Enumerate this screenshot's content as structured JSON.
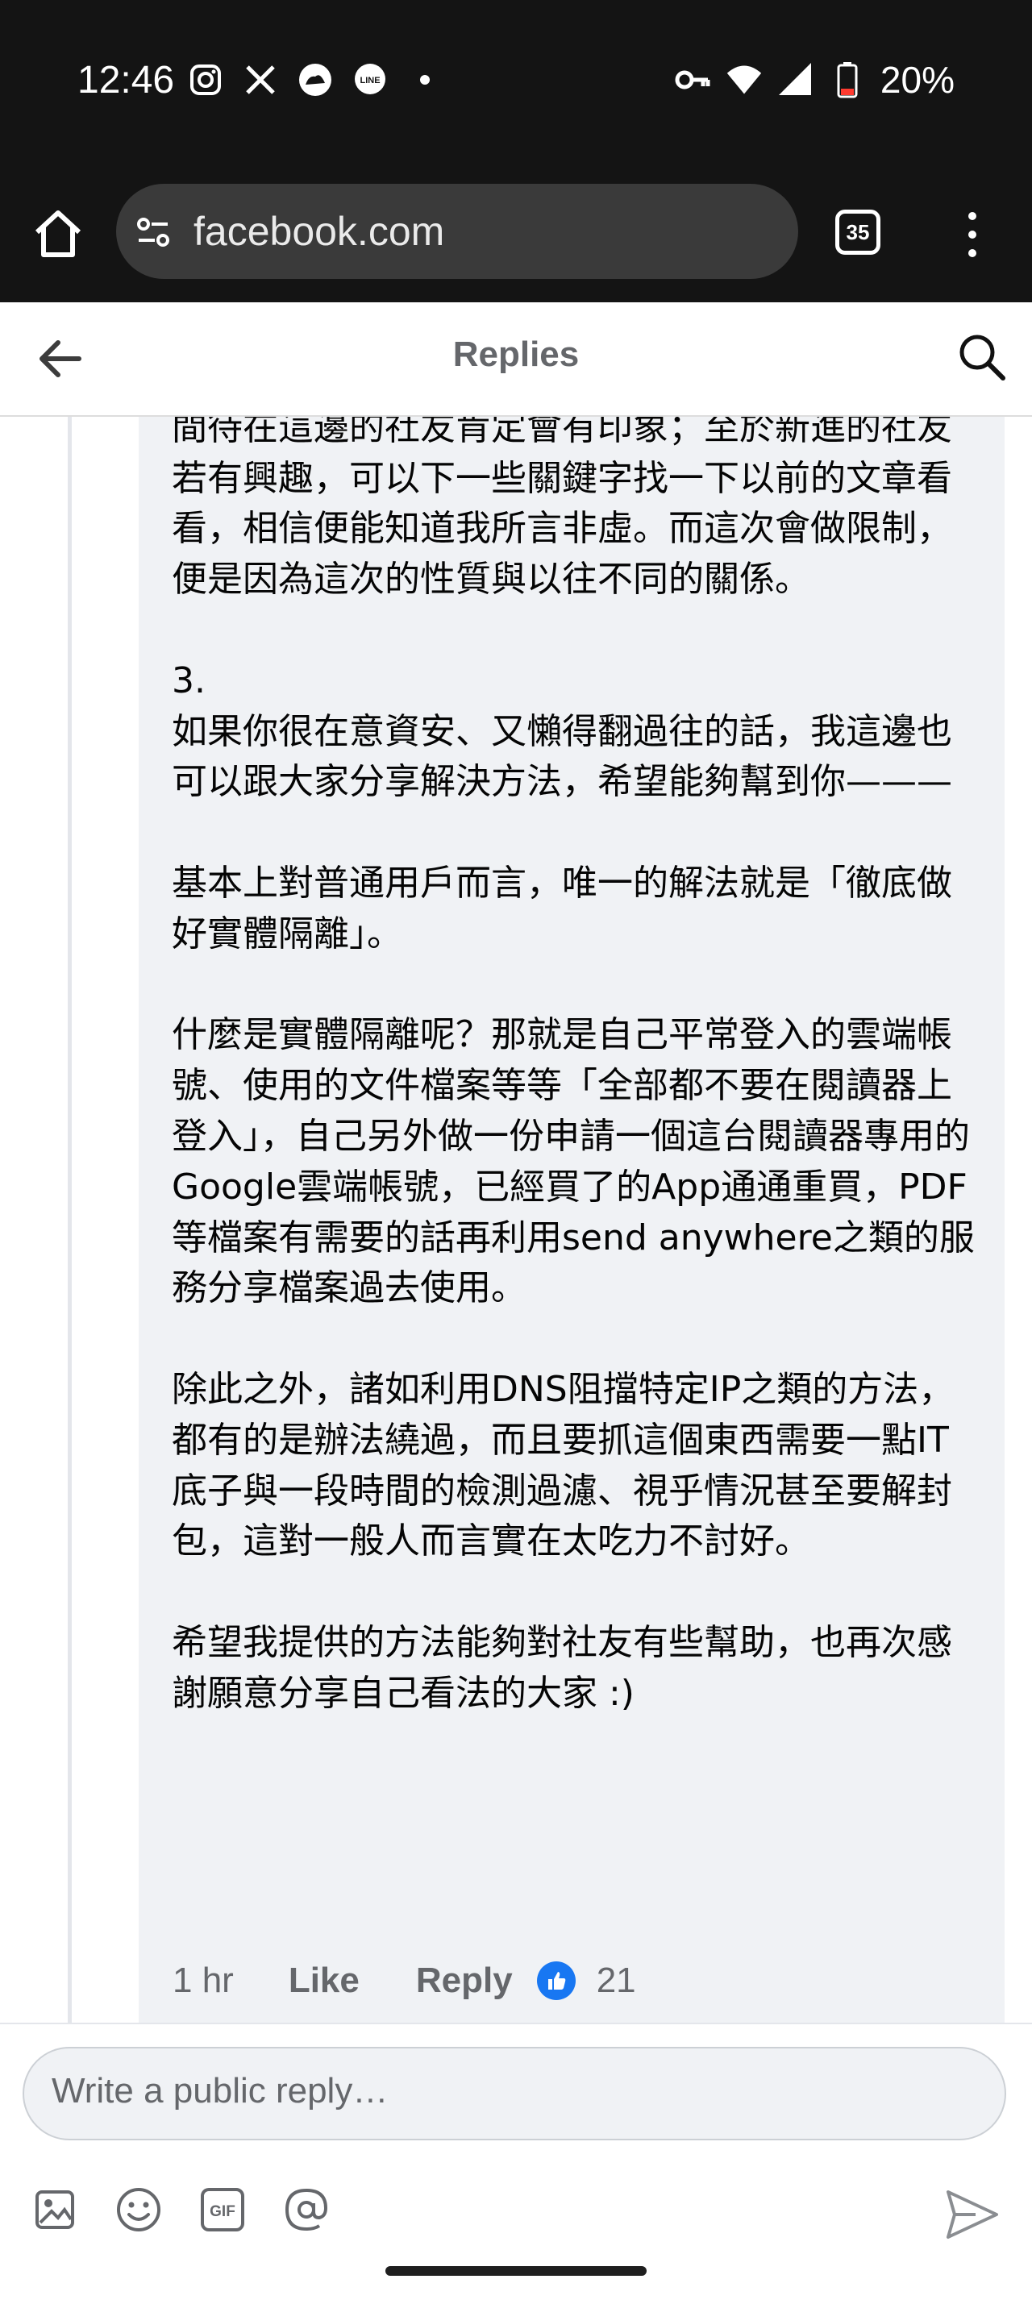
{
  "status_bar": {
    "time": "12:46",
    "battery": "20%",
    "left_icons": [
      "instagram-icon",
      "x-icon",
      "cloud-app-icon",
      "line-icon",
      "dot-icon"
    ],
    "right_icons": [
      "key-icon",
      "wifi-icon",
      "signal-icon",
      "battery-icon"
    ]
  },
  "browser": {
    "url": "facebook.com",
    "tab_count": "35"
  },
  "header": {
    "title": "Replies"
  },
  "comment": {
    "text": "討論，而我們從來都是歡迎討論的態度，相信長時間待在這邊的社友肯定會有印象；至於新進的社友若有興趣，可以下一些關鍵字找一下以前的文章看看，相信便能知道我所言非虛。而這次會做限制，便是因為這次的性質與以往不同的關係。\n\n3.\n如果你很在意資安、又懶得翻過往的話，我這邊也可以跟大家分享解決方法，希望能夠幫到你———\n\n基本上對普通用戶而言，唯一的解法就是「徹底做好實體隔離」。\n\n什麼是實體隔離呢？那就是自己平常登入的雲端帳號、使用的文件檔案等等「全部都不要在閱讀器上登入」，自己另外做一份申請一個這台閱讀器專用的Google雲端帳號，已經買了的App通通重買，PDF等檔案有需要的話再利用send anywhere之類的服務分享檔案過去使用。\n\n除此之外，諸如利用DNS阻擋特定IP之類的方法，都有的是辦法繞過，而且要抓這個東西需要一點IT底子與一段時間的檢測過濾、視乎情況甚至要解封包，這對一般人而言實在太吃力不討好。\n\n希望我提供的方法能夠對社友有些幫助，也再次感謝願意分享自己看法的大家 :)",
    "time": "1 hr",
    "like_label": "Like",
    "reply_label": "Reply",
    "reaction_count": "21"
  },
  "composer": {
    "placeholder": "Write a public reply…",
    "tools": [
      "photo-icon",
      "emoji-icon",
      "gif-icon",
      "mention-icon"
    ]
  },
  "colors": {
    "facebook_blue": "#1877f2",
    "bubble_bg": "#f0f2f5",
    "secondary_text": "#65676b"
  }
}
